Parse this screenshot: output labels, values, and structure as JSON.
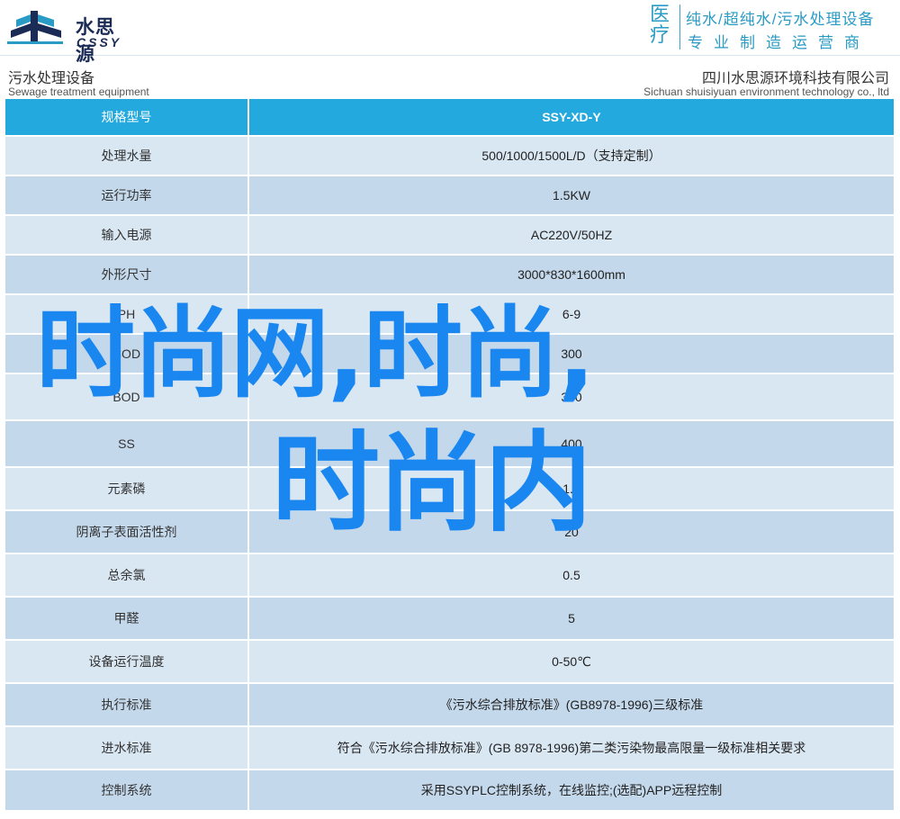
{
  "header": {
    "logo_cn": "水思源",
    "logo_en": "CSSY",
    "badge_chars": [
      "医",
      "疗"
    ],
    "slogan_line1": "纯水/超纯水/污水处理设备",
    "slogan_line2": "专业制造运营商"
  },
  "subheader": {
    "left_cn": "污水处理设备",
    "left_en": "Sewage treatment equipment",
    "right_cn": "四川水思源环境科技有限公司",
    "right_en": "Sichuan shuisiyuan environment technology co., ltd"
  },
  "table": {
    "header": {
      "key": "规格型号",
      "value": "SSY-XD-Y"
    },
    "rows": [
      {
        "key": "处理水量",
        "value": "500/1000/1500L/D（支持定制）"
      },
      {
        "key": "运行功率",
        "value": "1.5KW"
      },
      {
        "key": "输入电源",
        "value": "AC220V/50HZ"
      },
      {
        "key": "外形尺寸",
        "value": "3000*830*1600mm"
      },
      {
        "key": "PH",
        "value": "6-9"
      },
      {
        "key": "COD",
        "value": "300"
      },
      {
        "key": "BOD",
        "value": "300"
      },
      {
        "key": "SS",
        "value": "400"
      },
      {
        "key": "元素磷",
        "value": "1.5"
      },
      {
        "key": "阴离子表面活性剂",
        "value": "20"
      },
      {
        "key": "总余氯",
        "value": "0.5"
      },
      {
        "key": "甲醛",
        "value": "5"
      },
      {
        "key": "设备运行温度",
        "value": "0-50℃"
      },
      {
        "key": "执行标准",
        "value": "《污水综合排放标准》(GB8978-1996)三级标准"
      },
      {
        "key": "进水标准",
        "value": "符合《污水综合排放标准》(GB 8978-1996)第二类污染物最高限量一级标准相关要求"
      },
      {
        "key": "控制系统",
        "value": "采用SSYPLC控制系统，在线监控;(选配)APP远程控制"
      }
    ]
  },
  "overlay": {
    "line1": "时尚网,时尚,",
    "line2": "时尚内"
  },
  "colors": {
    "header_row": "#23a9dd",
    "row_light": "#d9e7f3",
    "row_dark": "#c4d8eb",
    "overlay_text": "#1a87f0",
    "brand_navy": "#1a2b56",
    "slogan": "#2a9bc4"
  }
}
